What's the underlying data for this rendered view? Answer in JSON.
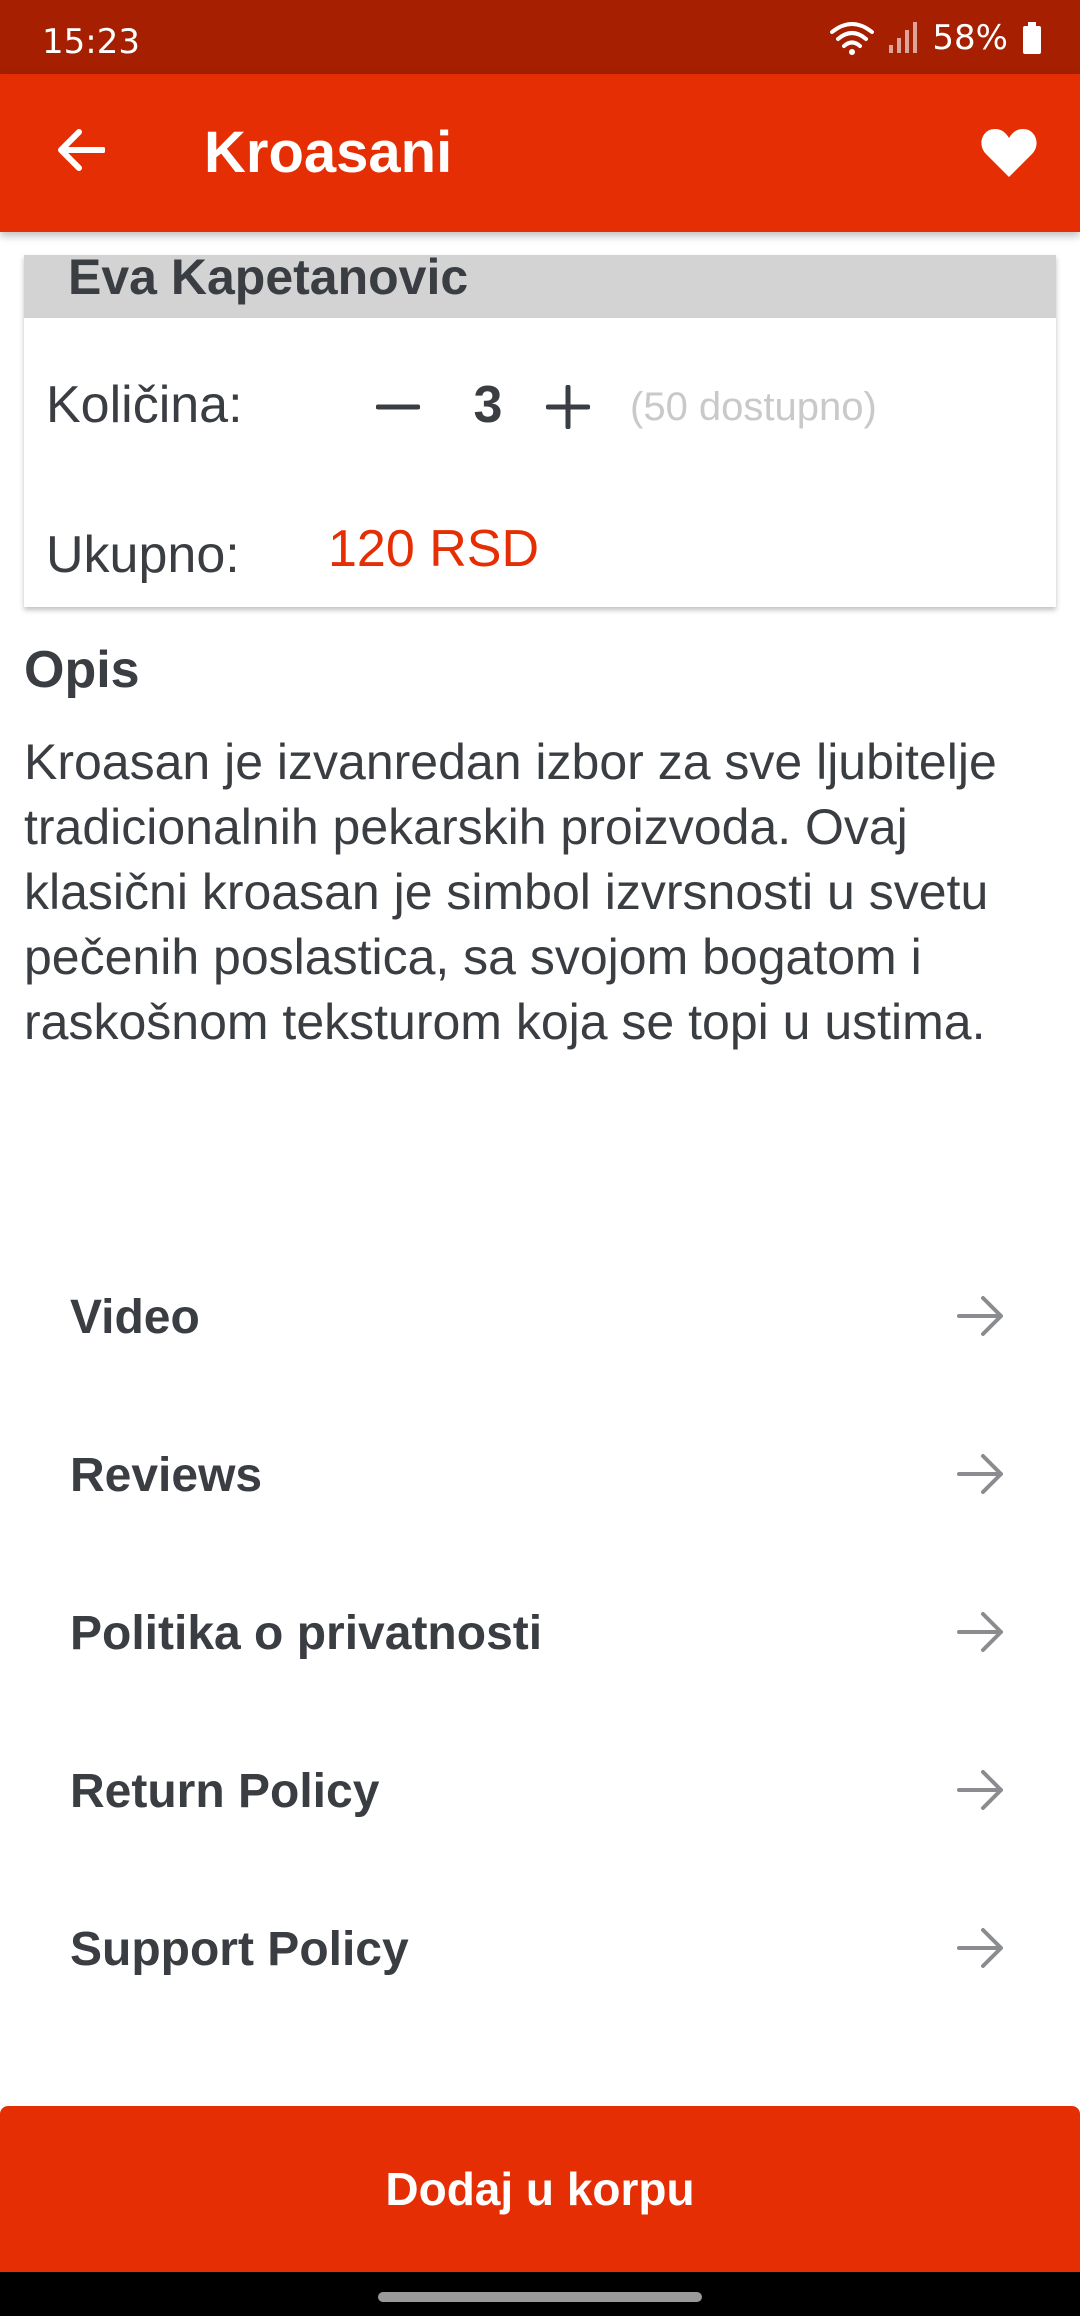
{
  "status_bar": {
    "time": "15:23",
    "battery": "58%"
  },
  "app_bar": {
    "title": "Kroasani"
  },
  "product_card": {
    "author": "Eva Kapetanovic",
    "quantity_label": "Količina:",
    "quantity_value": "3",
    "quantity_available": "(50 dostupno)",
    "total_label": "Ukupno:",
    "total_value": "120 RSD"
  },
  "description": {
    "title": "Opis",
    "text": "Kroasan je izvanredan izbor za sve ljubitelje tradicionalnih pekarskih proizvoda. Ovaj klasični kroasan je simbol izvrsnosti u svetu pečenih poslastica, sa svojom bogatom i raskošnom teksturom koja se topi u ustima."
  },
  "links": [
    {
      "label": "Video"
    },
    {
      "label": "Reviews"
    },
    {
      "label": "Politika o privatnosti"
    },
    {
      "label": "Return Policy"
    },
    {
      "label": "Support Policy"
    }
  ],
  "cta": {
    "label": "Dodaj u korpu"
  },
  "colors": {
    "primary": "#e52e04",
    "status_bar": "#a61f00",
    "text": "#3a3d42",
    "muted": "#c9c9c9"
  }
}
